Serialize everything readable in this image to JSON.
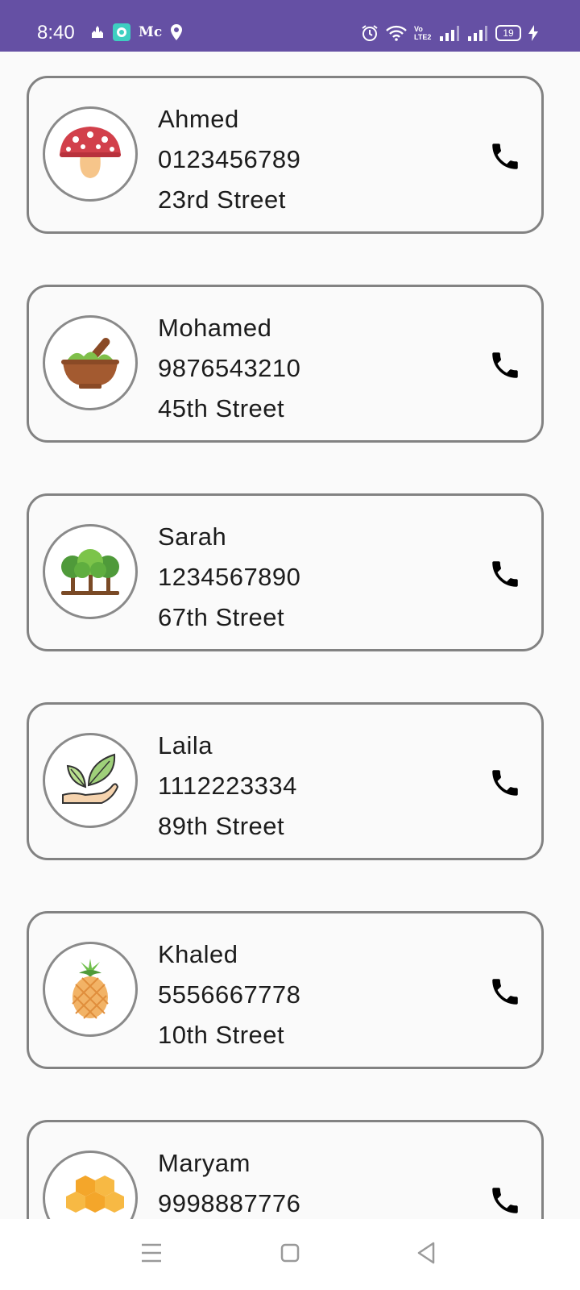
{
  "status_bar": {
    "time": "8:40",
    "left_icons": [
      "prayer-icon",
      "chat-app-icon",
      "messenger-icon",
      "location-icon"
    ],
    "left_glyph_messenger": "Mc",
    "right_icons": [
      "alarm-icon",
      "wifi-icon",
      "volte-icon",
      "signal-icon",
      "signal-icon",
      "battery-icon",
      "charging-icon"
    ],
    "volte_label": "Vo LTE2",
    "battery_level": "19",
    "background": "#6550a4"
  },
  "contacts": [
    {
      "name": "Ahmed",
      "phone": "0123456789",
      "address": "23rd Street",
      "avatar_icon": "mushroom-icon"
    },
    {
      "name": "Mohamed",
      "phone": "9876543210",
      "address": "45th Street",
      "avatar_icon": "mortar-pestle-icon"
    },
    {
      "name": "Sarah",
      "phone": "1234567890",
      "address": "67th Street",
      "avatar_icon": "trees-icon"
    },
    {
      "name": "Laila",
      "phone": "1112223334",
      "address": "89th Street",
      "avatar_icon": "hand-leaves-icon"
    },
    {
      "name": "Khaled",
      "phone": "5556667778",
      "address": "10th Street",
      "avatar_icon": "pineapple-icon"
    },
    {
      "name": "Maryam",
      "phone": "9998887776",
      "address": "",
      "avatar_icon": "honeycomb-icon"
    }
  ],
  "call_icon": "phone-icon",
  "nav_bar": {
    "items": [
      "menu-icon",
      "home-icon",
      "back-icon"
    ]
  }
}
